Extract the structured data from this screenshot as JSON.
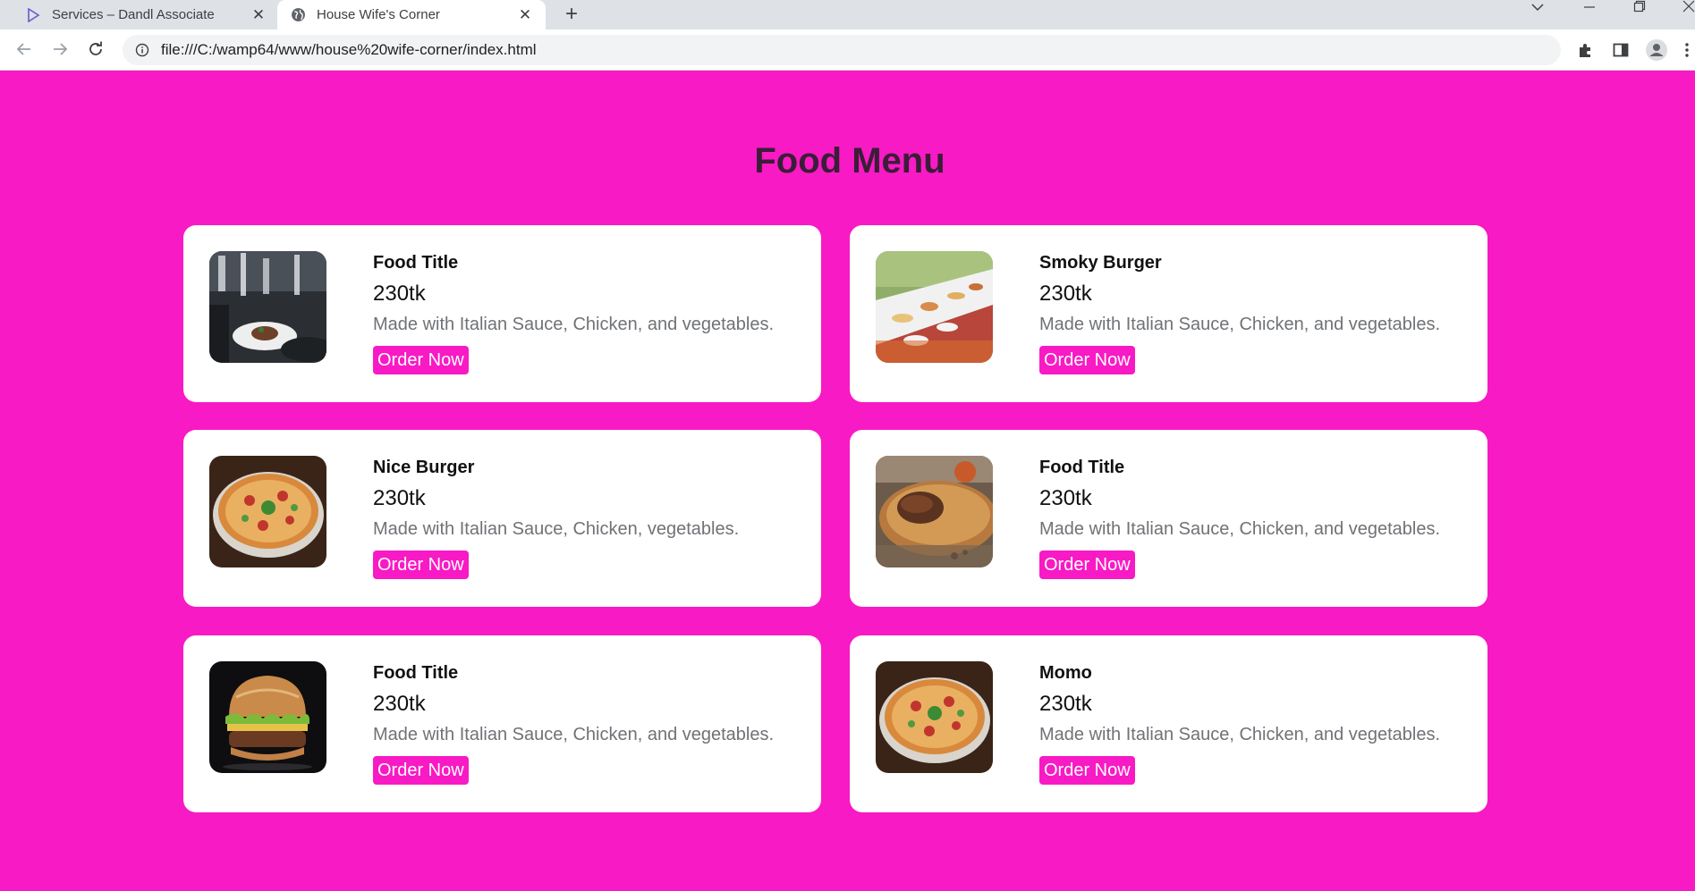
{
  "browser": {
    "tabs": [
      {
        "title": "Services – Dandl Associate",
        "icon": "triangle-logo-icon",
        "active": false
      },
      {
        "title": "House Wife's Corner",
        "icon": "globe-icon",
        "active": true
      }
    ],
    "new_tab": "+",
    "url": "file:///C:/wamp64/www/house%20wife-corner/index.html"
  },
  "page": {
    "title": "Food Menu",
    "accent_color": "#f81ac4",
    "items": [
      {
        "name": "Food Title",
        "price": "230tk",
        "description": "Made with Italian Sauce, Chicken, and vegetables.",
        "button": "Order Now",
        "image": "restaurant-dining-photo"
      },
      {
        "name": "Smoky Burger",
        "price": "230tk",
        "description": "Made with Italian Sauce, Chicken, and vegetables.",
        "button": "Order Now",
        "image": "banquet-table-photo"
      },
      {
        "name": "Nice Burger",
        "price": "230tk",
        "description": "Made with Italian Sauce, Chicken, vegetables.",
        "button": "Order Now",
        "image": "pizza-photo"
      },
      {
        "name": "Food Title",
        "price": "230tk",
        "description": "Made with Italian Sauce, Chicken, and vegetables.",
        "button": "Order Now",
        "image": "biryani-photo"
      },
      {
        "name": "Food Title",
        "price": "230tk",
        "description": "Made with Italian Sauce, Chicken, and vegetables.",
        "button": "Order Now",
        "image": "burger-photo"
      },
      {
        "name": "Momo",
        "price": "230tk",
        "description": "Made with Italian Sauce, Chicken, and vegetables.",
        "button": "Order Now",
        "image": "pizza-photo"
      }
    ]
  }
}
